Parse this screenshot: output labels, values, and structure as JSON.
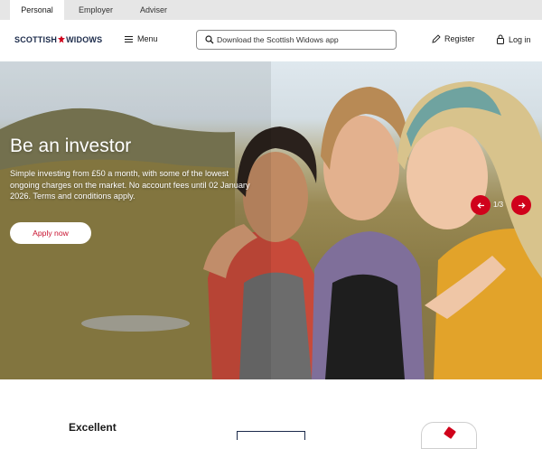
{
  "audience_tabs": [
    {
      "label": "Personal",
      "active": true
    },
    {
      "label": "Employer",
      "active": false
    },
    {
      "label": "Adviser",
      "active": false
    }
  ],
  "header": {
    "logo_left": "SCOTTISH",
    "logo_right": "WIDOWS",
    "menu_label": "Menu",
    "search_placeholder": "Download the Scottish Widows app",
    "register_label": "Register",
    "login_label": "Log in"
  },
  "hero": {
    "title": "Be an investor",
    "description": "Simple investing from £50 a month, with some of the lowest ongoing charges on the market. No account fees until 02 January 2026. Terms and conditions apply.",
    "cta_label": "Apply now",
    "slide_indicator": "1/3"
  },
  "trust": {
    "rating_label": "Excellent"
  },
  "colors": {
    "brand_red": "#d0021b",
    "brand_navy": "#1b2a4a",
    "tab_bar": "#e6e6e6"
  },
  "icons": [
    "menu-icon",
    "search-icon",
    "pencil-icon",
    "lock-icon",
    "arrow-left-icon",
    "arrow-right-icon"
  ]
}
